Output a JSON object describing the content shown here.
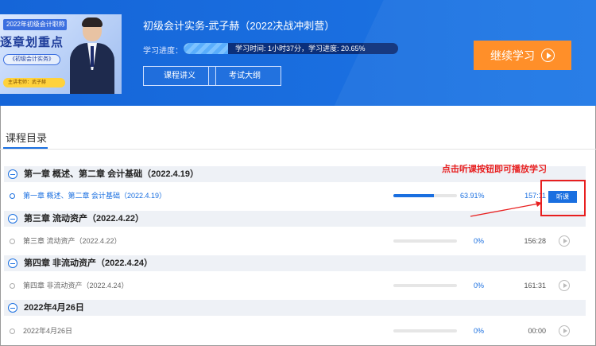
{
  "banner": {
    "cover": {
      "top_text": "2022年初级会计职称",
      "big_text": "逐章划重点",
      "sub_text": "《初级会计实务》",
      "tag_text": "主讲老师：武子赫"
    },
    "course_title": "初级会计实务-武子赫（2022决战冲刺营）",
    "progress_label": "学习进度：",
    "progress_text": "学习时间: 1小时37分，学习进度: 20.65%",
    "progress_fraction": 0.2065,
    "buttons": {
      "handout": "课程讲义",
      "syllabus": "考试大纲",
      "continue": "继续学习"
    }
  },
  "catalog": {
    "title": "课程目录",
    "chapters": [
      {
        "title": "第一章   概述、第二章   会计基础（2022.4.19）"
      },
      {
        "title": "第三章   流动资产（2022.4.22）"
      },
      {
        "title": "第四章   非流动资产（2022.4.24）"
      },
      {
        "title": "2022年4月26日"
      }
    ],
    "lessons": [
      {
        "name": "第一章   概述、第二章   会计基础（2022.4.19）",
        "percent": "63.91%",
        "fraction": 0.6391,
        "duration": "157:11",
        "action": "听课"
      },
      {
        "name": "第三章   流动资产（2022.4.22）",
        "percent": "0%",
        "fraction": 0,
        "duration": "156:28"
      },
      {
        "name": "第四章   非流动资产（2022.4.24）",
        "percent": "0%",
        "fraction": 0,
        "duration": "161:31"
      },
      {
        "name": "2022年4月26日",
        "percent": "0%",
        "fraction": 0,
        "duration": "00:00"
      }
    ]
  },
  "annotation": {
    "text": "点击听课按钮即可播放学习",
    "color": "#e81f1f"
  },
  "colors": {
    "accent": "#1a6fe0",
    "continue": "#ff8a1e"
  }
}
